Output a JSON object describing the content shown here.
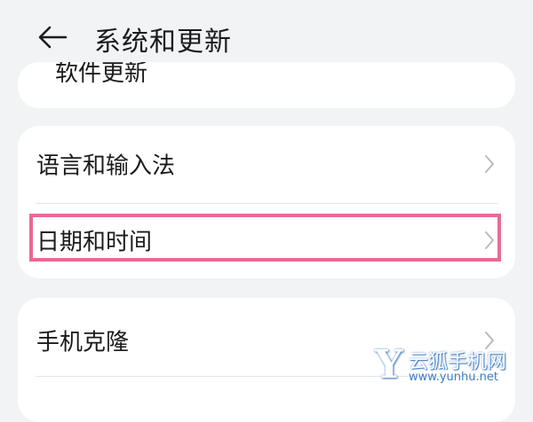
{
  "header": {
    "back_icon": "arrow-left-icon",
    "title": "系统和更新"
  },
  "top_card": {
    "clipped_label": "软件更新"
  },
  "group1": {
    "items": [
      {
        "label": "语言和输入法"
      },
      {
        "label": "日期和时间"
      }
    ]
  },
  "group2": {
    "items": [
      {
        "label": "手机克隆"
      }
    ]
  },
  "highlight_color": "#e86a94",
  "watermark": {
    "letter": "Y",
    "name": "云狐手机网",
    "url": "www.yunhu.net"
  }
}
